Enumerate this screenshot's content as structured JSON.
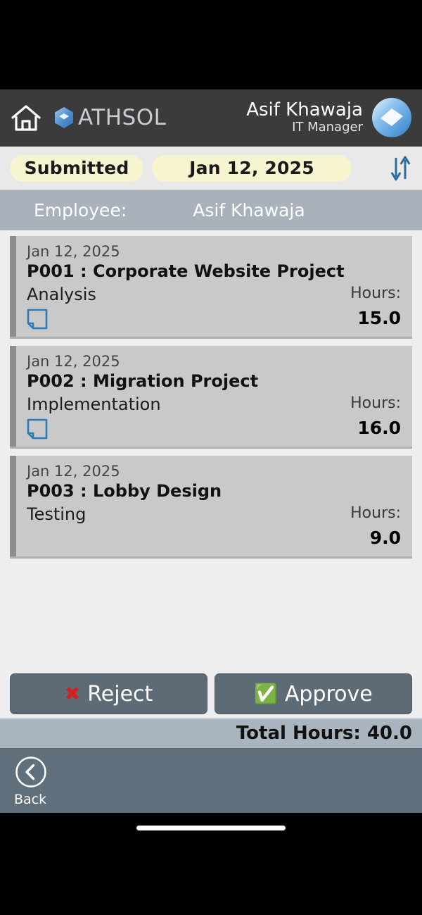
{
  "header": {
    "home_icon": "home-icon",
    "brand_name": "ATHSOL",
    "brand_mark": "hexagon-logo-icon",
    "user_name": "Asif Khawaja",
    "user_role": "IT Manager",
    "avatar": "user-avatar"
  },
  "filters": {
    "status_chip": "Submitted",
    "date_chip": "Jan 12, 2025",
    "sort_icon": "sort-updown-icon"
  },
  "employee": {
    "label": "Employee:",
    "value": "Asif Khawaja"
  },
  "entries": [
    {
      "date": "Jan 12, 2025",
      "title": "P001 : Corporate Website Project",
      "task": "Analysis",
      "hours_label": "Hours:",
      "hours": "15.0",
      "has_note": true
    },
    {
      "date": "Jan 12, 2025",
      "title": "P002 : Migration Project",
      "task": "Implementation",
      "hours_label": "Hours:",
      "hours": "16.0",
      "has_note": true
    },
    {
      "date": "Jan 12, 2025",
      "title": "P003 : Lobby Design",
      "task": "Testing",
      "hours_label": "Hours:",
      "hours": "9.0",
      "has_note": false
    }
  ],
  "actions": {
    "reject_label": "Reject",
    "reject_glyph": "✖",
    "approve_label": "Approve",
    "approve_glyph": "✅"
  },
  "total": {
    "text": "Total Hours: 40.0"
  },
  "bottom_nav": {
    "back_label": "Back",
    "back_icon": "chevron-left-circle-icon"
  },
  "colors": {
    "header_bg": "#3b3b3b",
    "chip_bg": "#f7f5cf",
    "employee_bar": "#a9b2ba",
    "card_bg": "#c9c9c9",
    "card_accent": "#8e8e8e",
    "button_bg": "#5d6b77",
    "total_bar": "#aab4bf",
    "bottom_nav": "#5f6f7c",
    "accent_blue": "#2b7bb9",
    "reject_red": "#d32020",
    "approve_green": "#22a83a"
  }
}
